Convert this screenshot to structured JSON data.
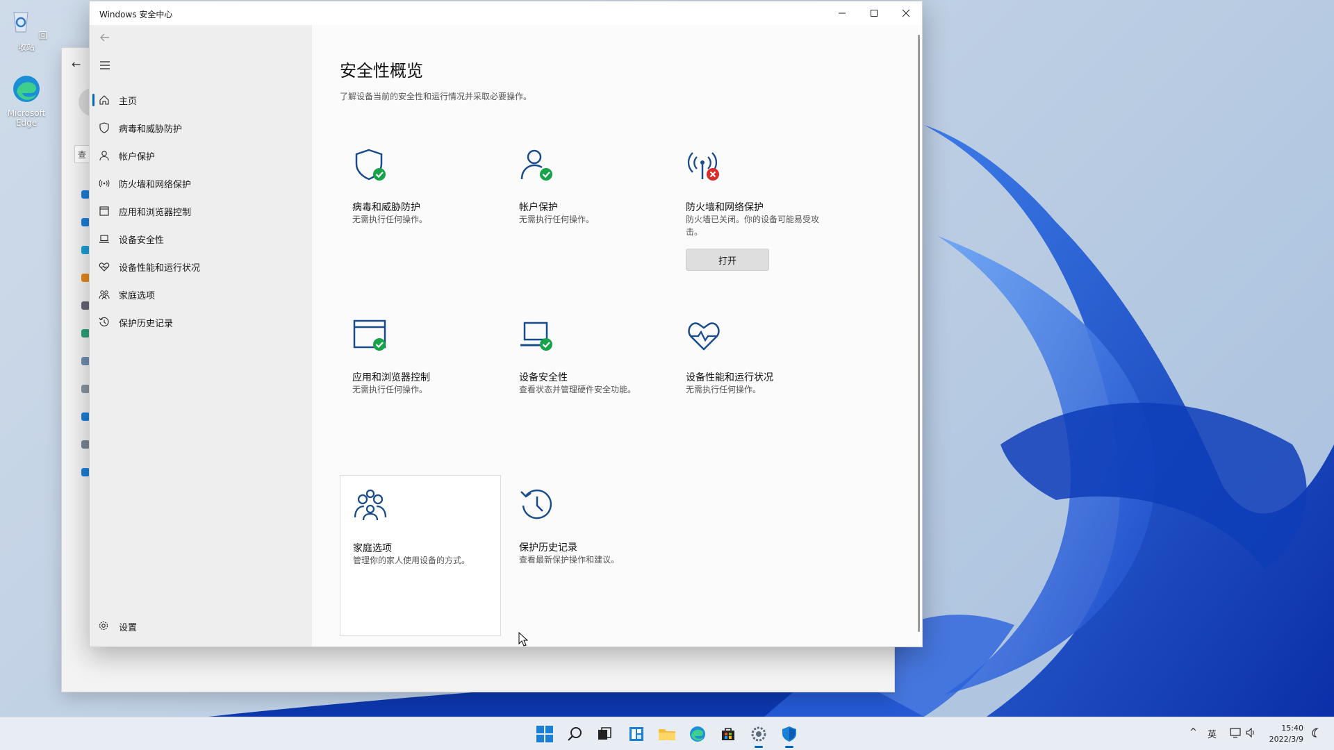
{
  "desktop": {
    "icons": [
      {
        "label": "回收站",
        "icon": "recycle-bin-icon"
      },
      {
        "label": "Microsoft Edge",
        "icon": "edge-icon"
      }
    ]
  },
  "background_window": {
    "search_placeholder": "查"
  },
  "window": {
    "title": "Windows 安全中心",
    "minimize": "—",
    "maximize": "☐",
    "close": "✕"
  },
  "sidebar": {
    "back": "←",
    "items": [
      {
        "label": "主页",
        "icon": "home-icon"
      },
      {
        "label": "病毒和威胁防护",
        "icon": "shield-icon"
      },
      {
        "label": "帐户保护",
        "icon": "person-icon"
      },
      {
        "label": "防火墙和网络保护",
        "icon": "wifi-antenna-icon"
      },
      {
        "label": "应用和浏览器控制",
        "icon": "app-window-icon"
      },
      {
        "label": "设备安全性",
        "icon": "laptop-icon"
      },
      {
        "label": "设备性能和运行状况",
        "icon": "heart-pulse-icon"
      },
      {
        "label": "家庭选项",
        "icon": "family-icon"
      },
      {
        "label": "保护历史记录",
        "icon": "history-icon"
      }
    ],
    "settings": "设置"
  },
  "main": {
    "title": "安全性概览",
    "subtitle": "了解设备当前的安全性和运行情况并采取必要操作。",
    "tiles": [
      {
        "name": "病毒和威胁防护",
        "desc": "无需执行任何操作。",
        "icon": "shield-check-icon",
        "status": "ok"
      },
      {
        "name": "帐户保护",
        "desc": "无需执行任何操作。",
        "icon": "account-check-icon",
        "status": "ok"
      },
      {
        "name": "防火墙和网络保护",
        "desc": "防火墙已关闭。你的设备可能易受攻击。",
        "icon": "firewall-error-icon",
        "status": "error",
        "button": "打开"
      },
      {
        "name": "应用和浏览器控制",
        "desc": "无需执行任何操作。",
        "icon": "browser-check-icon",
        "status": "ok"
      },
      {
        "name": "设备安全性",
        "desc": "查看状态并管理硬件安全功能。",
        "icon": "laptop-check-icon",
        "status": "ok"
      },
      {
        "name": "设备性能和运行状况",
        "desc": "无需执行任何操作。",
        "icon": "heart-pulse-icon",
        "status": "none"
      },
      {
        "name": "家庭选项",
        "desc": "管理你的家人使用设备的方式。",
        "icon": "family-icon",
        "status": "none"
      },
      {
        "name": "保护历史记录",
        "desc": "查看最新保护操作和建议。",
        "icon": "history-icon",
        "status": "none"
      }
    ]
  },
  "taskbar": {
    "apps": [
      "start-icon",
      "search-icon",
      "task-view-icon",
      "widgets-icon",
      "file-explorer-icon",
      "edge-icon",
      "store-icon",
      "settings-icon",
      "windows-security-icon"
    ],
    "tray": {
      "chevron": "^",
      "ime": "英"
    },
    "time": "15:40",
    "date": "2022/3/9"
  },
  "colors": {
    "accent": "#0067c0",
    "ok_green": "#16a34a",
    "error_red": "#d92c2c",
    "icon_blue": "#1a4c8c"
  }
}
